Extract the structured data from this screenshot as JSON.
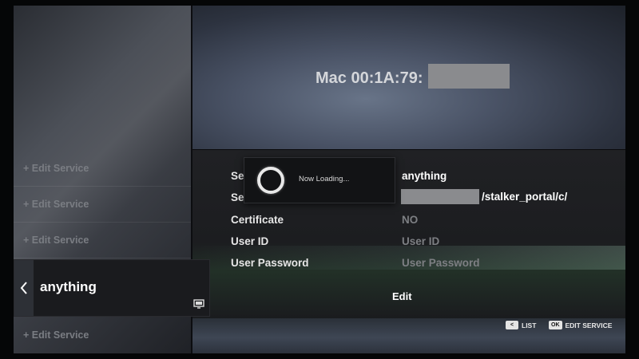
{
  "device": {
    "mac_label": "Mac 00:1A:79:"
  },
  "sidebar": {
    "items": [
      {
        "label": "+ Edit Service"
      },
      {
        "label": "+ Edit Service"
      },
      {
        "label": "+ Edit Service"
      },
      {
        "label": "+ Edit Service"
      }
    ],
    "active_item": {
      "label": "anything"
    }
  },
  "details": {
    "fields": [
      {
        "label": "Se",
        "value": "anything"
      },
      {
        "label": "Se",
        "value": "/stalker_portal/c/"
      },
      {
        "label": "Certificate",
        "value": "NO"
      },
      {
        "label": "User ID",
        "value": "User ID"
      },
      {
        "label": "User Password",
        "value": "User Password"
      }
    ],
    "edit_label": "Edit"
  },
  "loading": {
    "text": "Now Loading..."
  },
  "hints": [
    {
      "key": "<",
      "label": "LIST"
    },
    {
      "key": "OK",
      "label": "EDIT SERVICE"
    }
  ],
  "icons": {
    "back": "chevron-left-icon",
    "monitor": "monitor-icon",
    "spinner": "loading-spinner-icon"
  }
}
